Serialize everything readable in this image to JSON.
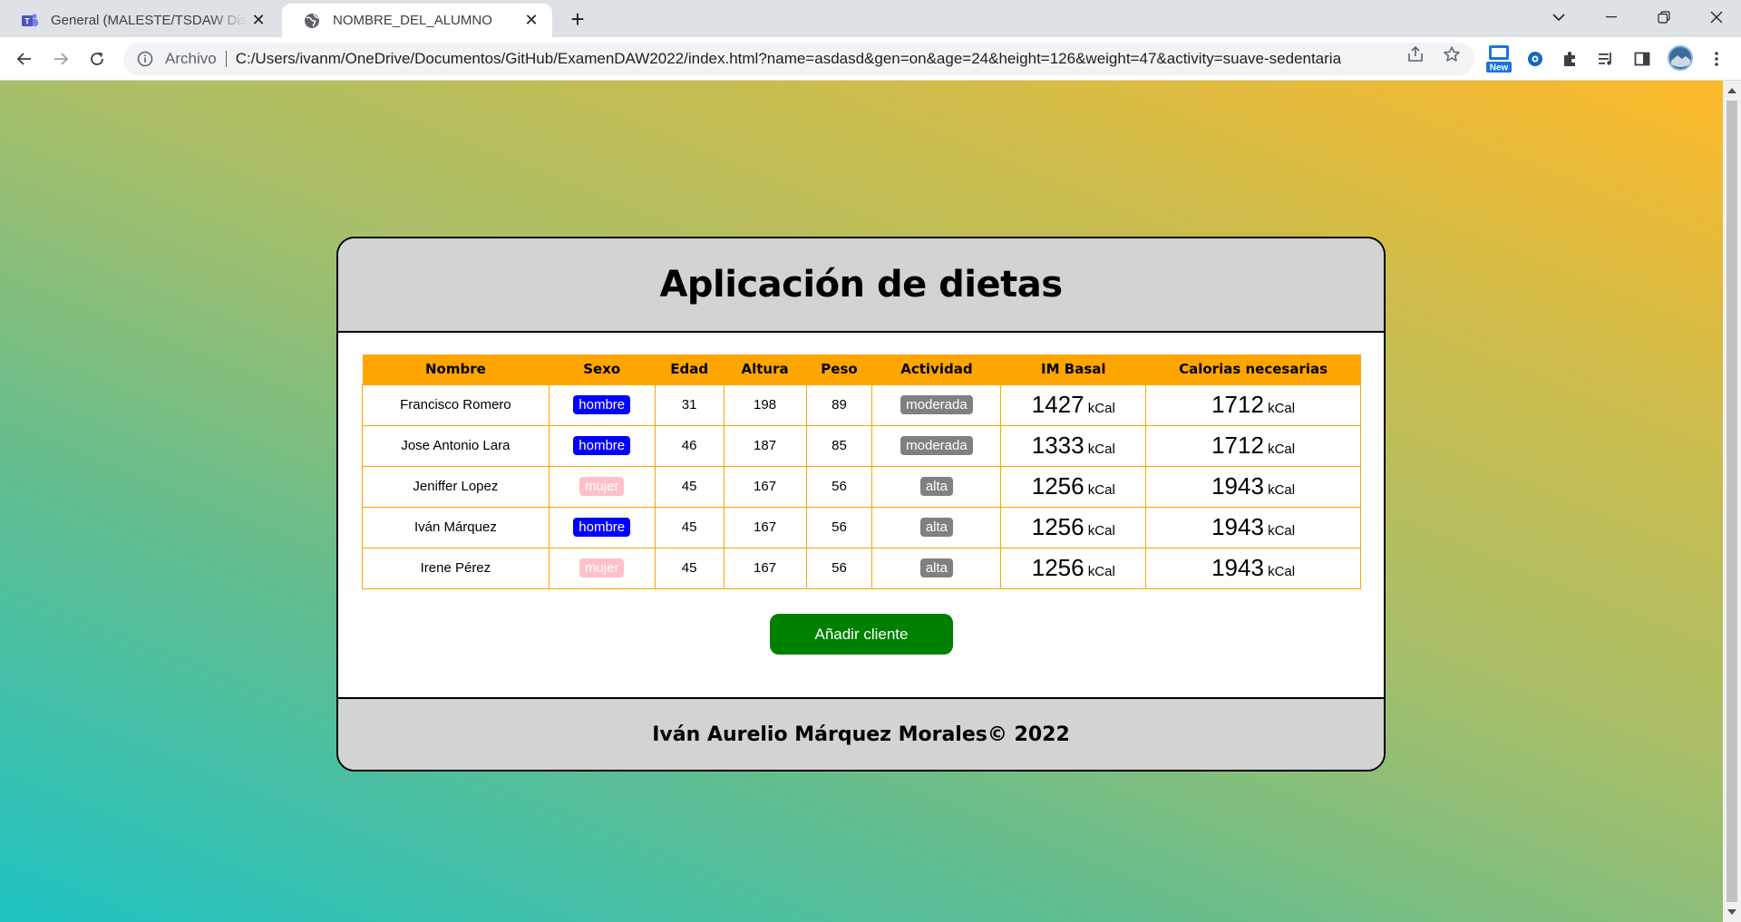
{
  "browser": {
    "tabs": [
      {
        "title": "General (MALESTE/TSDAW Diseño",
        "active": false,
        "icon": "teams-icon"
      },
      {
        "title": "NOMBRE_DEL_ALUMNO",
        "active": true,
        "icon": "globe-icon"
      }
    ],
    "address": {
      "scheme_label": "Archivo",
      "url": "C:/Users/ivanm/OneDrive/Documentos/GitHub/ExamenDAW2022/index.html?name=asdasd&gen=on&age=24&height=126&weight=47&activity=suave-sedentaria"
    },
    "extension_badge": "New"
  },
  "page": {
    "title": "Aplicación de dietas",
    "columns": [
      "Nombre",
      "Sexo",
      "Edad",
      "Altura",
      "Peso",
      "Actividad",
      "IM Basal",
      "Calorias necesarias"
    ],
    "unit": "kCal",
    "rows": [
      {
        "nombre": "Francisco Romero",
        "sexo": "hombre",
        "edad": "31",
        "altura": "198",
        "peso": "89",
        "actividad": "moderada",
        "basal": "1427",
        "calorias": "1712"
      },
      {
        "nombre": "Jose Antonio Lara",
        "sexo": "hombre",
        "edad": "46",
        "altura": "187",
        "peso": "85",
        "actividad": "moderada",
        "basal": "1333",
        "calorias": "1712"
      },
      {
        "nombre": "Jeniffer Lopez",
        "sexo": "mujer",
        "edad": "45",
        "altura": "167",
        "peso": "56",
        "actividad": "alta",
        "basal": "1256",
        "calorias": "1943"
      },
      {
        "nombre": "Iván Márquez",
        "sexo": "hombre",
        "edad": "45",
        "altura": "167",
        "peso": "56",
        "actividad": "alta",
        "basal": "1256",
        "calorias": "1943"
      },
      {
        "nombre": "Irene Pérez",
        "sexo": "mujer",
        "edad": "45",
        "altura": "167",
        "peso": "56",
        "actividad": "alta",
        "basal": "1256",
        "calorias": "1943"
      }
    ],
    "add_button": "Añadir cliente",
    "footer": "Iván Aurelio Márquez Morales© 2022"
  },
  "colors": {
    "header_bg": "#d3d3d3",
    "table_header": "#ffa500",
    "hombre_badge": "#0000ff",
    "mujer_badge": "#ffc0cb",
    "activity_badge": "#808080",
    "button": "#008000"
  }
}
